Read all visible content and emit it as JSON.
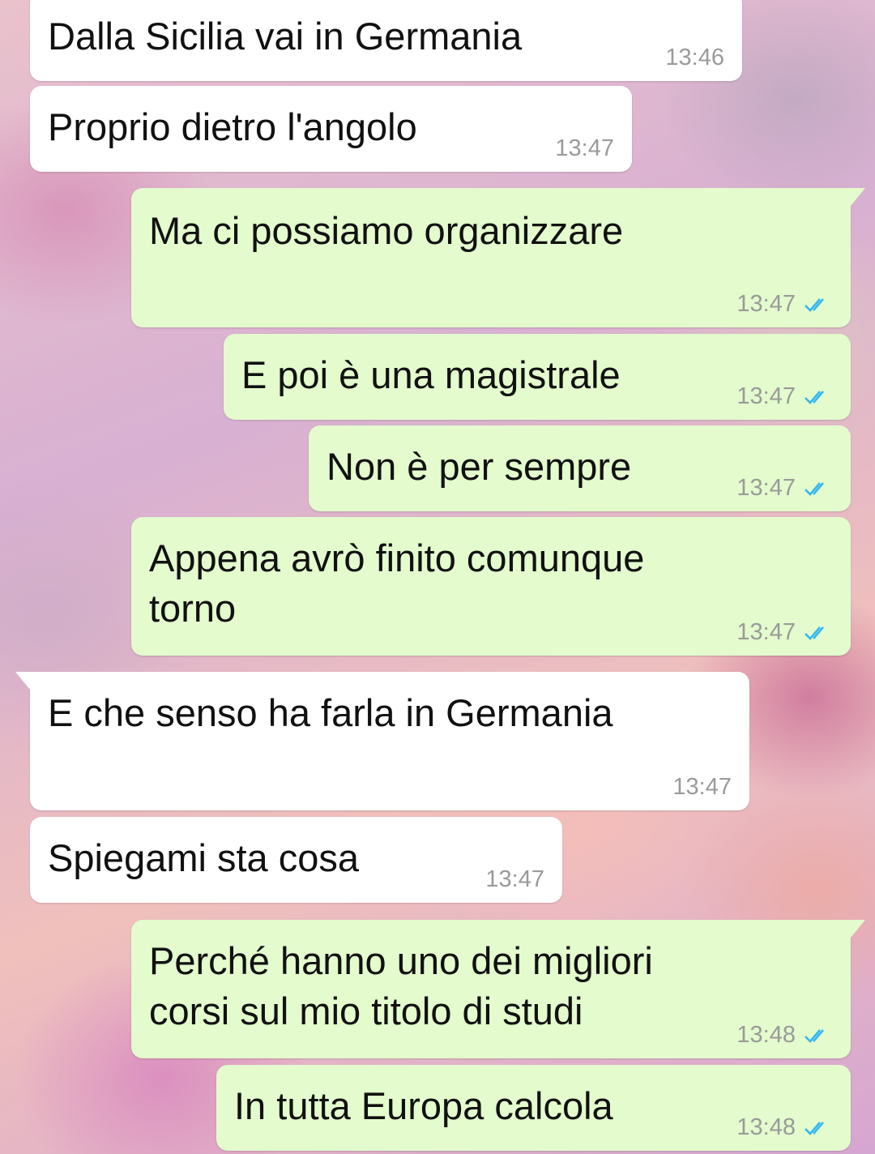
{
  "colors": {
    "incoming_bubble": "#ffffff",
    "outgoing_bubble": "#e3fbcd",
    "read_ticks": "#34b7f1",
    "timestamp": "#9a9a9a"
  },
  "messages": [
    {
      "direction": "in",
      "text": "Dalla Sicilia vai in Germania",
      "time": "13:46"
    },
    {
      "direction": "in",
      "text": "Proprio dietro l'angolo",
      "time": "13:47"
    },
    {
      "direction": "out",
      "text": "Ma ci possiamo organizzare",
      "time": "13:47",
      "status_icon": "double-check-read-icon"
    },
    {
      "direction": "out",
      "text": "E poi è una magistrale",
      "time": "13:47",
      "status_icon": "double-check-read-icon"
    },
    {
      "direction": "out",
      "text": "Non è per sempre",
      "time": "13:47",
      "status_icon": "double-check-read-icon"
    },
    {
      "direction": "out",
      "text": "Appena avrò finito comunque\ntorno",
      "time": "13:47",
      "status_icon": "double-check-read-icon"
    },
    {
      "direction": "in",
      "text": "E che senso ha farla in Germania",
      "time": "13:47"
    },
    {
      "direction": "in",
      "text": "Spiegami sta cosa",
      "time": "13:47"
    },
    {
      "direction": "out",
      "text": "Perché hanno uno dei migliori\ncorsi sul mio titolo di studi",
      "time": "13:48",
      "status_icon": "double-check-read-icon"
    },
    {
      "direction": "out",
      "text": "In tutta Europa calcola",
      "time": "13:48",
      "status_icon": "double-check-read-icon"
    }
  ]
}
